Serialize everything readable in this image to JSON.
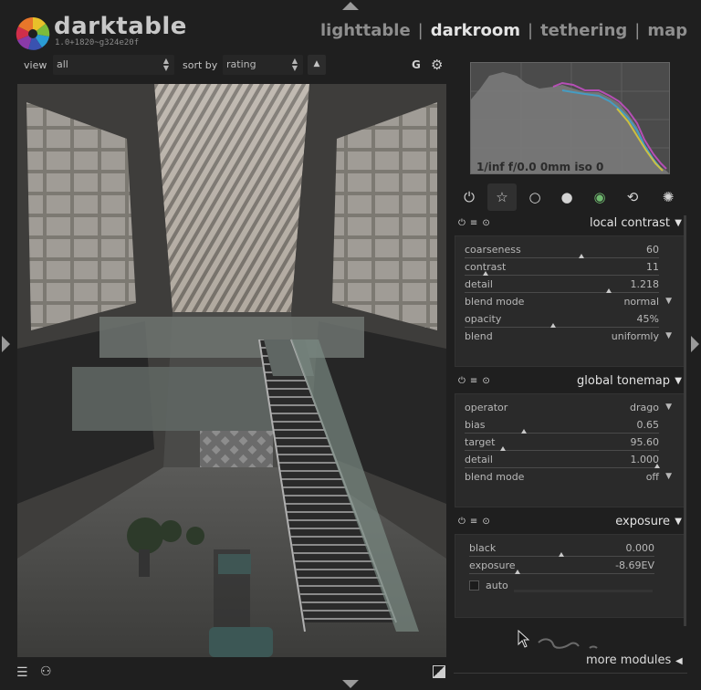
{
  "app": {
    "name": "darktable",
    "version": "1.0+1820~g324e20f"
  },
  "views": [
    {
      "label": "lighttable",
      "active": false
    },
    {
      "label": "darkroom",
      "active": true
    },
    {
      "label": "tethering",
      "active": false
    },
    {
      "label": "map",
      "active": false
    }
  ],
  "view_separator": "|",
  "filter": {
    "view_label": "view",
    "view_value": "all",
    "sort_label": "sort by",
    "sort_value": "rating",
    "sort_order_icon": "triangle-up",
    "grouping_label": "G",
    "prefs_icon": "gear-icon"
  },
  "histogram": {
    "info": "1/inf f/0.0 0mm iso 0"
  },
  "module_groups": [
    {
      "icon": "power-icon",
      "glyph": "⏻",
      "active": false
    },
    {
      "icon": "star-icon",
      "glyph": "☆",
      "active": true
    },
    {
      "icon": "circle-icon",
      "glyph": "○",
      "active": false
    },
    {
      "icon": "sphere-icon",
      "glyph": "●",
      "active": false
    },
    {
      "icon": "color-icon",
      "glyph": "◉",
      "active": false
    },
    {
      "icon": "correct-icon",
      "glyph": "⟲",
      "active": false
    },
    {
      "icon": "effect-icon",
      "glyph": "✺",
      "active": false
    }
  ],
  "modules": [
    {
      "title": "local contrast",
      "params": [
        {
          "label": "coarseness",
          "value": "60",
          "type": "slider",
          "level": 0.6
        },
        {
          "label": "contrast",
          "value": "11",
          "type": "slider",
          "level": 0.1
        },
        {
          "label": "detail",
          "value": "1.218",
          "type": "slider",
          "level": 0.73
        },
        {
          "label": "blend mode",
          "value": "normal",
          "type": "combo"
        },
        {
          "label": "opacity",
          "value": "45%",
          "type": "slider",
          "level": 0.45
        },
        {
          "label": "blend",
          "value": "uniformly",
          "type": "combo"
        }
      ]
    },
    {
      "title": "global tonemap",
      "params": [
        {
          "label": "operator",
          "value": "drago",
          "type": "combo"
        },
        {
          "label": "bias",
          "value": "0.65",
          "type": "slider",
          "level": 0.3
        },
        {
          "label": "target",
          "value": "95.60",
          "type": "slider",
          "level": 0.2
        },
        {
          "label": "detail",
          "value": "1.000",
          "type": "slider",
          "level": 0.99
        },
        {
          "label": "blend mode",
          "value": "off",
          "type": "combo"
        }
      ]
    },
    {
      "title": "exposure",
      "params": [
        {
          "label": "black",
          "value": "0.000",
          "type": "slider",
          "level": 0.5
        },
        {
          "label": "exposure",
          "value": "-8.69EV",
          "type": "slider",
          "level": 0.25
        }
      ],
      "auto_label": "auto"
    }
  ],
  "more_modules": "more modules"
}
